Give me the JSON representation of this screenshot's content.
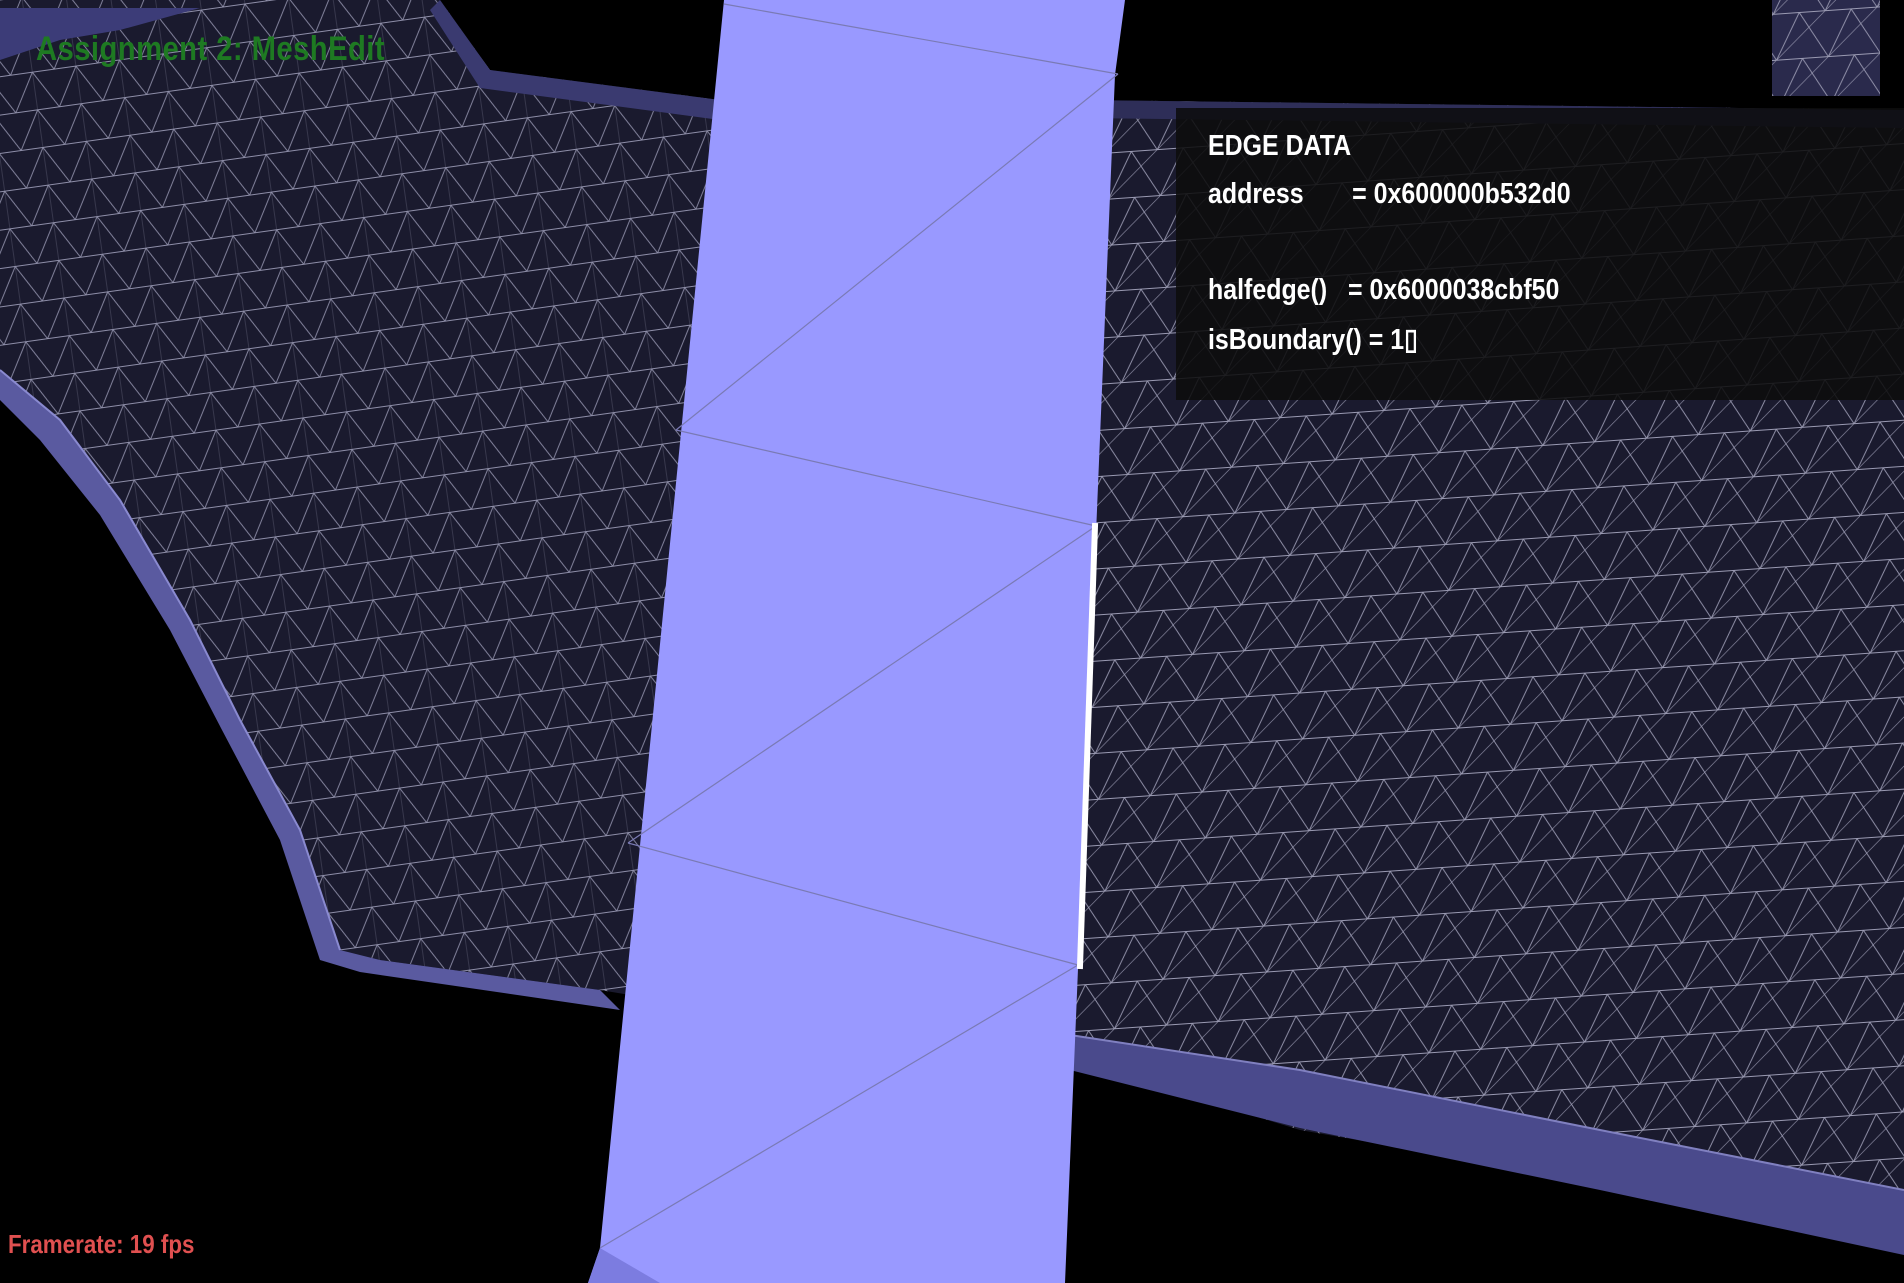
{
  "app": {
    "title": "Assignment 2: MeshEdit"
  },
  "status": {
    "framerate": "Framerate: 19 fps"
  },
  "edge_panel": {
    "heading": "EDGE DATA",
    "address_line": "address       = 0x600000b532d0",
    "halfedge_line": "halfedge()   = 0x6000038cbf50",
    "is_boundary_line": "isBoundary() = 1▯"
  },
  "colors": {
    "background": "#000000",
    "mesh_face": "#1a1a2e",
    "mesh_edge": "#9a9ab0",
    "selected_strip": "#9999ff",
    "selected_edge": "#ffffff",
    "title_text": "#1e7a22",
    "framerate_text": "#e05050"
  }
}
